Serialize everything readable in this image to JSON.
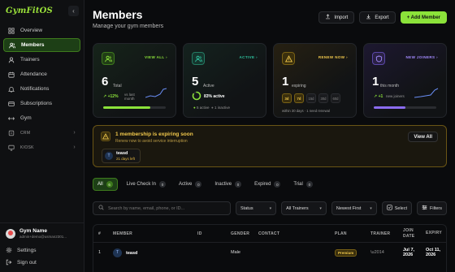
{
  "app": {
    "logo": "GymFitOS"
  },
  "sidebar": {
    "items": [
      {
        "label": "Overview",
        "icon": "grid-icon"
      },
      {
        "label": "Members",
        "icon": "users-icon",
        "active": true
      },
      {
        "label": "Trainers",
        "icon": "user-icon"
      },
      {
        "label": "Attendance",
        "icon": "calendar-icon"
      },
      {
        "label": "Notifications",
        "icon": "bell-icon"
      },
      {
        "label": "Subscriptions",
        "icon": "card-icon"
      },
      {
        "label": "Gym",
        "icon": "dumbbell-icon"
      }
    ],
    "groups": [
      {
        "label": "CRM",
        "icon": "crm-icon"
      },
      {
        "label": "KIOSK",
        "icon": "monitor-icon"
      }
    ],
    "gym_name": "Gym Name",
    "gym_email": "admin+demo@usman2301...",
    "settings": "Settings",
    "signout": "Sign out"
  },
  "header": {
    "title": "Members",
    "subtitle": "Manage your gym members",
    "import": "Import",
    "export": "Export",
    "add": "+ Add Member"
  },
  "cards": {
    "total": {
      "link": "VIEW ALL",
      "value": "6",
      "label": "Total",
      "trend": "+12%",
      "trend_note": "vs last month",
      "progress": 0.75
    },
    "active": {
      "link": "ACTIVE",
      "value": "5",
      "label": "Active",
      "percent": "83% active",
      "ratio": 0.83,
      "active_count": "5 active",
      "inactive_count": "1 inactive"
    },
    "expiring": {
      "link": "RENEW NOW",
      "value": "1",
      "label": "expiring",
      "windows": [
        "3d",
        "7d",
        "15d",
        "30d",
        "60d"
      ],
      "selected_window": 1,
      "note": "within 30 days · 1 need renewal"
    },
    "joiners": {
      "link": "NEW JOINERS",
      "value": "1",
      "label": "this month",
      "trend": "+1",
      "trend_note": "new joiners",
      "progress": 0.5
    }
  },
  "alert": {
    "title": "1 membership is expiring soon",
    "subtitle": "Renew now to avoid service interruption",
    "view_all": "View All",
    "member_initial": "T",
    "member_name": "teasd",
    "member_days": "21 days left"
  },
  "tabs": [
    {
      "label": "All",
      "count": "6",
      "active": true
    },
    {
      "label": "Live Check In",
      "count": "0"
    },
    {
      "label": "Active",
      "count": "0"
    },
    {
      "label": "Inactive",
      "count": "0"
    },
    {
      "label": "Expired",
      "count": "0"
    },
    {
      "label": "Trial",
      "count": "0"
    }
  ],
  "filters": {
    "search_placeholder": "Search by name, email, phone, or ID...",
    "status": "Status",
    "trainers": "All Trainers",
    "sort": "Newest First",
    "select": "Select",
    "filters": "Filters"
  },
  "table": {
    "headers": [
      "#",
      "MEMBER",
      "ID",
      "GENDER",
      "CONTACT",
      "PLAN",
      "TRAINER",
      "JOIN DATE",
      "EXPIRY"
    ],
    "rows": [
      {
        "num": "1",
        "initial": "T",
        "member": "teasd",
        "id": "",
        "gender": "Male",
        "contact": "",
        "plan": "Premium",
        "trainer": "\\u2014",
        "join": "Jul 7, 2026",
        "expiry": "Oct 11, 2026"
      }
    ]
  },
  "colors": {
    "accent": "#8be23a",
    "warning": "#f2c94c",
    "teal": "#2ec4a0",
    "purple": "#8b6cf0"
  }
}
